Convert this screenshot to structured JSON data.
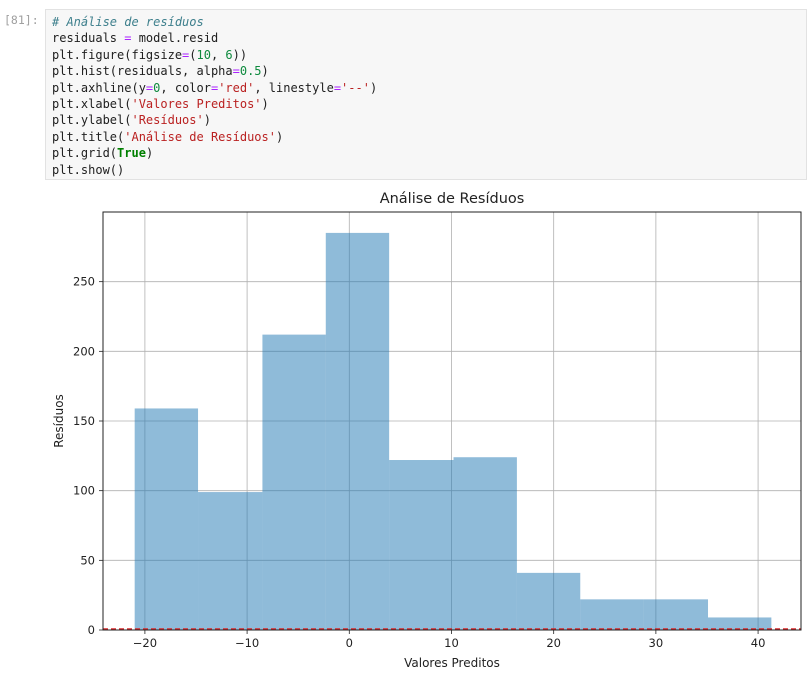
{
  "cell": {
    "prompt": "[81]:",
    "code_lines": [
      [
        {
          "t": "# Análise de resíduos",
          "c": "t-comment"
        }
      ],
      [
        {
          "t": "residuals ",
          "c": "t-fn"
        },
        {
          "t": "=",
          "c": "t-op"
        },
        {
          "t": " model.resid",
          "c": "t-fn"
        }
      ],
      [
        {
          "t": "plt.figure(figsize",
          "c": "t-fn"
        },
        {
          "t": "=",
          "c": "t-op"
        },
        {
          "t": "(",
          "c": "t-fn"
        },
        {
          "t": "10",
          "c": "t-num"
        },
        {
          "t": ", ",
          "c": "t-fn"
        },
        {
          "t": "6",
          "c": "t-num"
        },
        {
          "t": "))",
          "c": "t-fn"
        }
      ],
      [
        {
          "t": "plt.hist(residuals, alpha",
          "c": "t-fn"
        },
        {
          "t": "=",
          "c": "t-op"
        },
        {
          "t": "0.5",
          "c": "t-num"
        },
        {
          "t": ")",
          "c": "t-fn"
        }
      ],
      [
        {
          "t": "plt.axhline(y",
          "c": "t-fn"
        },
        {
          "t": "=",
          "c": "t-op"
        },
        {
          "t": "0",
          "c": "t-num"
        },
        {
          "t": ", color",
          "c": "t-fn"
        },
        {
          "t": "=",
          "c": "t-op"
        },
        {
          "t": "'red'",
          "c": "t-str"
        },
        {
          "t": ", linestyle",
          "c": "t-fn"
        },
        {
          "t": "=",
          "c": "t-op"
        },
        {
          "t": "'--'",
          "c": "t-str"
        },
        {
          "t": ")",
          "c": "t-fn"
        }
      ],
      [
        {
          "t": "plt.xlabel(",
          "c": "t-fn"
        },
        {
          "t": "'Valores Preditos'",
          "c": "t-str"
        },
        {
          "t": ")",
          "c": "t-fn"
        }
      ],
      [
        {
          "t": "plt.ylabel(",
          "c": "t-fn"
        },
        {
          "t": "'Resíduos'",
          "c": "t-str"
        },
        {
          "t": ")",
          "c": "t-fn"
        }
      ],
      [
        {
          "t": "plt.title(",
          "c": "t-fn"
        },
        {
          "t": "'Análise de Resíduos'",
          "c": "t-str"
        },
        {
          "t": ")",
          "c": "t-fn"
        }
      ],
      [
        {
          "t": "plt.grid(",
          "c": "t-fn"
        },
        {
          "t": "True",
          "c": "t-kw"
        },
        {
          "t": ")",
          "c": "t-fn"
        }
      ],
      [
        {
          "t": "plt.show()",
          "c": "t-fn"
        }
      ]
    ]
  },
  "chart_data": {
    "type": "bar",
    "title": "Análise de Resíduos",
    "xlabel": "Valores Preditos",
    "ylabel": "Resíduos",
    "xlim": [
      -24.1,
      44.2
    ],
    "ylim": [
      0,
      300
    ],
    "grid": true,
    "bin_edges": [
      -21.0,
      -14.8,
      -8.5,
      -2.3,
      3.9,
      10.2,
      16.4,
      22.6,
      28.8,
      35.1,
      41.3
    ],
    "counts": [
      159,
      99,
      212,
      285,
      122,
      124,
      41,
      22,
      22,
      9
    ],
    "bar_color": "#1f77b4",
    "bar_alpha": 0.5,
    "xticks": [
      -20,
      -10,
      0,
      10,
      20,
      30,
      40
    ],
    "xtick_labels": [
      "−20",
      "−10",
      "0",
      "10",
      "20",
      "30",
      "40"
    ],
    "yticks": [
      0,
      50,
      100,
      150,
      200,
      250
    ],
    "ytick_labels": [
      "0",
      "50",
      "100",
      "150",
      "200",
      "250"
    ],
    "hline": {
      "y": 0,
      "color": "#d62728",
      "linestyle": "dashed"
    }
  }
}
